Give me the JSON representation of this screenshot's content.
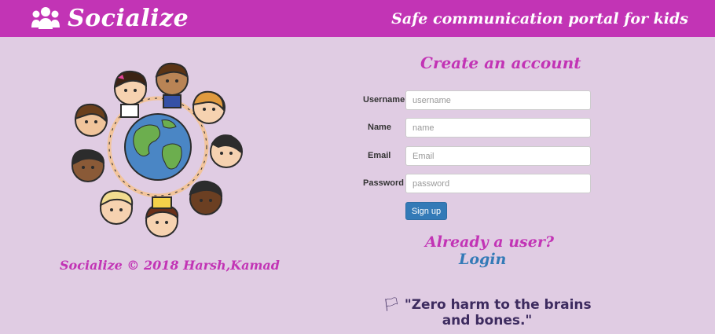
{
  "header": {
    "brand": "Socialize",
    "brand_icon": "users-icon",
    "tagline": "Safe communication portal for kids",
    "background": "#c234b5"
  },
  "illustration": {
    "icon": "kids-around-globe-illustration"
  },
  "footer": {
    "text": "Socialize © 2018 Harsh,Kamad"
  },
  "form": {
    "title": "Create an account",
    "fields": [
      {
        "label": "Username",
        "placeholder": "username"
      },
      {
        "label": "Name",
        "placeholder": "name"
      },
      {
        "label": "Email",
        "placeholder": "Email"
      },
      {
        "label": "Password",
        "placeholder": "password"
      }
    ],
    "submit_label": "Sign up",
    "already_user": "Already a user?",
    "login_label": "Login"
  },
  "quote": {
    "icon": "flag-icon",
    "text": "\"Zero harm to the brains and bones.\""
  },
  "colors": {
    "accent": "#c234b5",
    "page_background": "#e0cce3",
    "button": "#337ab7"
  }
}
